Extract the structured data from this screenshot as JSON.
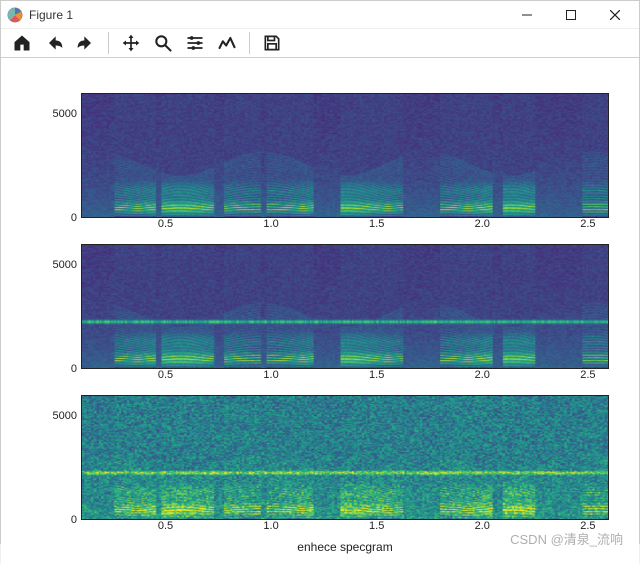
{
  "window": {
    "title": "Figure 1"
  },
  "toolbar": {
    "items": [
      {
        "name": "home-icon"
      },
      {
        "name": "back-icon"
      },
      {
        "name": "forward-icon"
      },
      {
        "sep": true
      },
      {
        "name": "pan-icon"
      },
      {
        "name": "zoom-icon"
      },
      {
        "name": "configure-icon"
      },
      {
        "name": "edit-icon"
      },
      {
        "sep": true
      },
      {
        "name": "save-icon"
      }
    ]
  },
  "watermark": "CSDN @清泉_流响",
  "chart_data": [
    {
      "type": "heatmap",
      "title": "",
      "xlabel": "",
      "ylabel": "",
      "xlim": [
        0.1,
        2.6
      ],
      "ylim": [
        0,
        6000
      ],
      "xticks": [
        0.5,
        1.0,
        1.5,
        2.0,
        2.5
      ],
      "yticks": [
        0,
        5000
      ],
      "description": "spectrogram (clean/reference)",
      "colormap": "viridis"
    },
    {
      "type": "heatmap",
      "title": "",
      "xlabel": "",
      "ylabel": "",
      "xlim": [
        0.1,
        2.6
      ],
      "ylim": [
        0,
        6000
      ],
      "xticks": [
        0.5,
        1.0,
        1.5,
        2.0,
        2.5
      ],
      "yticks": [
        0,
        5000
      ],
      "description": "spectrogram (noisy, horizontal tonal interference band)",
      "colormap": "viridis"
    },
    {
      "type": "heatmap",
      "title": "",
      "xlabel": "enhece specgram",
      "ylabel": "",
      "xlim": [
        0.1,
        2.6
      ],
      "ylim": [
        0,
        6000
      ],
      "xticks": [
        0.5,
        1.0,
        1.5,
        2.0,
        2.5
      ],
      "yticks": [
        0,
        5000
      ],
      "description": "enhanced spectrogram",
      "colormap": "viridis"
    }
  ]
}
